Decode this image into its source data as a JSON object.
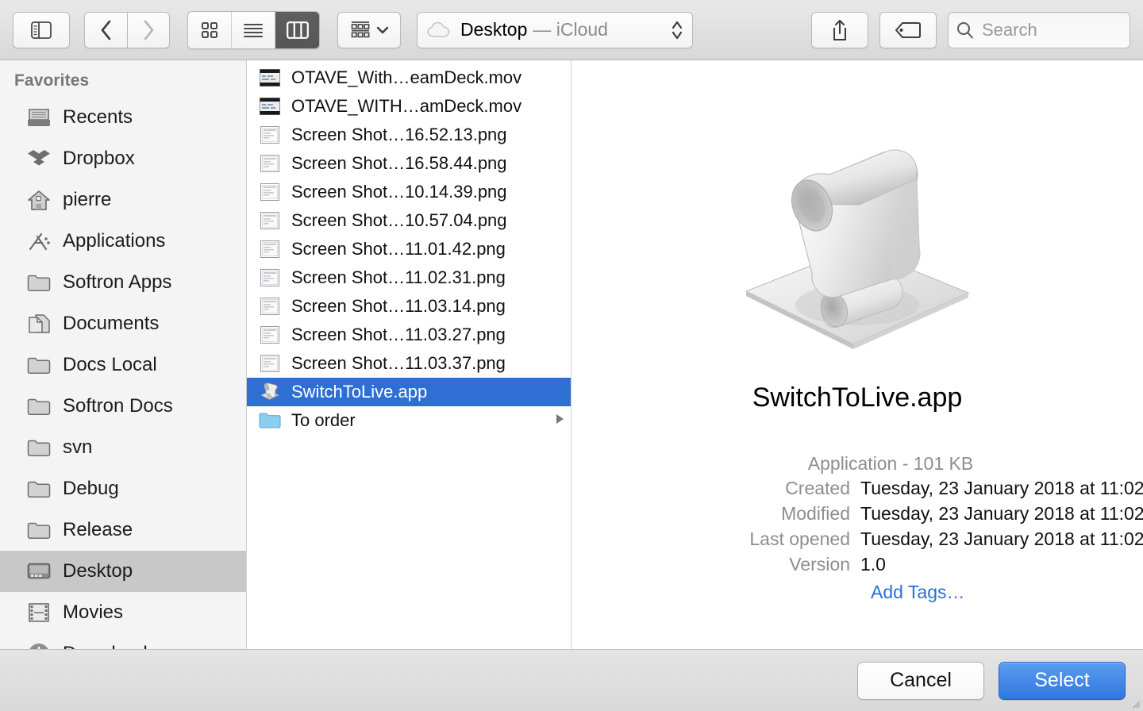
{
  "window": {
    "title": "Desktop",
    "title_suffix": "— iCloud"
  },
  "colors": {
    "selection_blue": "#2f6fd4",
    "accent_button_blue": "#2f77e0",
    "sidebar_bg": "#f4f4f4",
    "sidebar_selected": "#c8c8c8",
    "link_blue": "#2a6fd6"
  },
  "toolbar": {
    "sidebar_toggle": "sidebar-toggle-icon",
    "back": "chevron-left-icon",
    "forward": "chevron-right-icon",
    "view_modes": [
      {
        "name": "icon-view",
        "icon": "grid-icon",
        "active": false
      },
      {
        "name": "list-view",
        "icon": "list-icon",
        "active": false
      },
      {
        "name": "column-view",
        "icon": "columns-icon",
        "active": true
      }
    ],
    "arrange": {
      "icon": "arrange-grid-icon",
      "chevron": "chevron-down-icon"
    },
    "path_popup": {
      "icon": "icloud-cloud-icon",
      "stepper": "up-down-stepper-icon"
    },
    "share": "share-icon",
    "tags": "tag-icon",
    "search": {
      "icon": "search-icon",
      "placeholder": "Search",
      "value": ""
    }
  },
  "sidebar": {
    "header": "Favorites",
    "items": [
      {
        "label": "Recents",
        "icon": "recents-icon",
        "selected": false
      },
      {
        "label": "Dropbox",
        "icon": "dropbox-icon",
        "selected": false
      },
      {
        "label": "pierre",
        "icon": "home-icon",
        "selected": false
      },
      {
        "label": "Applications",
        "icon": "applications-icon",
        "selected": false
      },
      {
        "label": "Softron Apps",
        "icon": "folder-icon",
        "selected": false
      },
      {
        "label": "Documents",
        "icon": "documents-icon",
        "selected": false
      },
      {
        "label": "Docs Local",
        "icon": "folder-icon",
        "selected": false
      },
      {
        "label": "Softron Docs",
        "icon": "folder-icon",
        "selected": false
      },
      {
        "label": "svn",
        "icon": "folder-icon",
        "selected": false
      },
      {
        "label": "Debug",
        "icon": "folder-icon",
        "selected": false
      },
      {
        "label": "Release",
        "icon": "folder-icon",
        "selected": false
      },
      {
        "label": "Desktop",
        "icon": "desktop-icon",
        "selected": true
      },
      {
        "label": "Movies",
        "icon": "movies-icon",
        "selected": false
      },
      {
        "label": "Downloads",
        "icon": "downloads-icon",
        "selected": false
      }
    ]
  },
  "file_list": {
    "items": [
      {
        "name": "OTAVE_With…eamDeck.mov",
        "icon": "movie-thumbnail",
        "selected": false,
        "has_arrow": false
      },
      {
        "name": "OTAVE_WITH…amDeck.mov",
        "icon": "movie-thumbnail",
        "selected": false,
        "has_arrow": false
      },
      {
        "name": "Screen Shot…16.52.13.png",
        "icon": "image-thumbnail",
        "selected": false,
        "has_arrow": false
      },
      {
        "name": "Screen Shot…16.58.44.png",
        "icon": "image-thumbnail",
        "selected": false,
        "has_arrow": false
      },
      {
        "name": "Screen Shot…10.14.39.png",
        "icon": "image-thumbnail",
        "selected": false,
        "has_arrow": false
      },
      {
        "name": "Screen Shot…10.57.04.png",
        "icon": "image-thumbnail",
        "selected": false,
        "has_arrow": false
      },
      {
        "name": "Screen Shot…11.01.42.png",
        "icon": "image-thumbnail",
        "selected": false,
        "has_arrow": false
      },
      {
        "name": "Screen Shot…11.02.31.png",
        "icon": "image-thumbnail",
        "selected": false,
        "has_arrow": false
      },
      {
        "name": "Screen Shot…11.03.14.png",
        "icon": "image-thumbnail",
        "selected": false,
        "has_arrow": false
      },
      {
        "name": "Screen Shot…11.03.27.png",
        "icon": "image-thumbnail",
        "selected": false,
        "has_arrow": false
      },
      {
        "name": "Screen Shot…11.03.37.png",
        "icon": "image-thumbnail",
        "selected": false,
        "has_arrow": false
      },
      {
        "name": "SwitchToLive.app",
        "icon": "applescript-applet-icon",
        "selected": true,
        "has_arrow": false
      },
      {
        "name": "To order",
        "icon": "folder-blue-icon",
        "selected": false,
        "has_arrow": true
      }
    ]
  },
  "preview": {
    "icon": "applescript-applet-icon-large",
    "title": "SwitchToLive.app",
    "kind_and_size": "Application - 101 KB",
    "metadata": [
      {
        "key": "Created",
        "value": "Tuesday, 23 January 2018 at 11:02"
      },
      {
        "key": "Modified",
        "value": "Tuesday, 23 January 2018 at 11:02"
      },
      {
        "key": "Last opened",
        "value": "Tuesday, 23 January 2018 at 11:02"
      },
      {
        "key": "Version",
        "value": "1.0"
      }
    ],
    "add_tags": "Add Tags…"
  },
  "bottom_bar": {
    "cancel_label": "Cancel",
    "select_label": "Select"
  }
}
